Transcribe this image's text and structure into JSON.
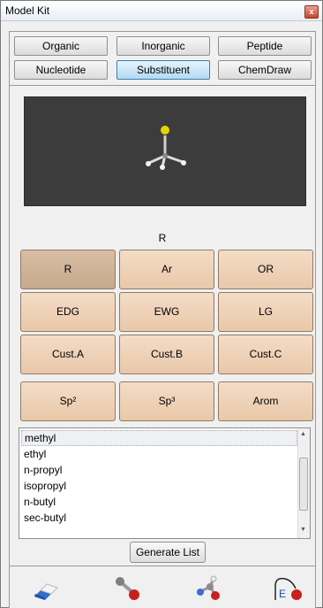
{
  "window": {
    "title": "Model Kit",
    "close_glyph": "x"
  },
  "tabs": [
    {
      "label": "Organic",
      "active": false
    },
    {
      "label": "Inorganic",
      "active": false
    },
    {
      "label": "Peptide",
      "active": false
    },
    {
      "label": "Nucleotide",
      "active": false
    },
    {
      "label": "Substituent",
      "active": true
    },
    {
      "label": "ChemDraw",
      "active": false
    }
  ],
  "selected_group_label": "R",
  "substituent_buttons": [
    {
      "label": "R",
      "selected": true
    },
    {
      "label": "Ar",
      "selected": false
    },
    {
      "label": "OR",
      "selected": false
    },
    {
      "label": "EDG",
      "selected": false
    },
    {
      "label": "EWG",
      "selected": false
    },
    {
      "label": "LG",
      "selected": false
    },
    {
      "label": "Cust.A",
      "selected": false
    },
    {
      "label": "Cust.B",
      "selected": false
    },
    {
      "label": "Cust.C",
      "selected": false
    },
    {
      "label": "Sp²",
      "selected": false
    },
    {
      "label": "Sp³",
      "selected": false
    },
    {
      "label": "Arom",
      "selected": false
    }
  ],
  "substituent_list": {
    "items": [
      "methyl",
      "ethyl",
      "n-propyl",
      "isopropyl",
      "n-butyl",
      "sec-butyl"
    ],
    "selected": "methyl"
  },
  "generate_button": "Generate List",
  "toolbar": [
    {
      "icon": "eraser-icon"
    },
    {
      "icon": "bond-icon"
    },
    {
      "icon": "fragment-icon"
    },
    {
      "icon": "element-icon",
      "text": "E"
    }
  ],
  "colors": {
    "button_fill": "#ecd0b6",
    "button_selected": "#cdb094",
    "viewer_bg": "#3c3c3c",
    "tab_active": "#bfe0f6"
  }
}
